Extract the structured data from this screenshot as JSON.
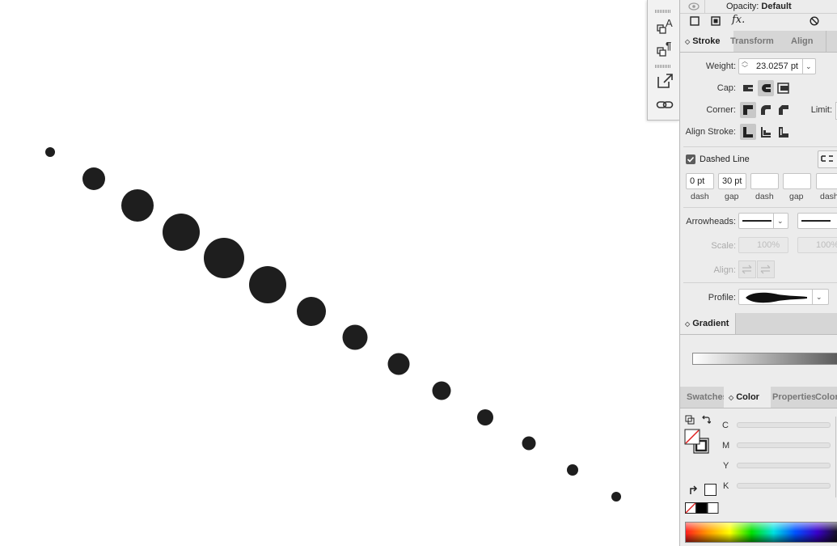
{
  "effects_panel": {
    "opacity_label": "Opacity:",
    "opacity_value": "Default",
    "fx_label": "fx."
  },
  "stroke_panel": {
    "tabs": [
      {
        "label": "Stroke",
        "active": true
      },
      {
        "label": "Transform",
        "active": false
      },
      {
        "label": "Align",
        "active": false
      }
    ],
    "weight_label": "Weight:",
    "weight_value": "23.0257 pt",
    "cap_label": "Cap:",
    "corner_label": "Corner:",
    "limit_label": "Limit:",
    "align_stroke_label": "Align Stroke:",
    "dashed_line": {
      "label": "Dashed Line",
      "checked": true
    },
    "dash_fields": [
      {
        "value": "0 pt",
        "caption": "dash"
      },
      {
        "value": "30 pt",
        "caption": "gap"
      },
      {
        "value": "",
        "caption": "dash"
      },
      {
        "value": "",
        "caption": "gap"
      },
      {
        "value": "",
        "caption": "dash"
      }
    ],
    "arrowheads_label": "Arrowheads:",
    "scale_label": "Scale:",
    "scale_start": "100%",
    "scale_end": "100%",
    "align_label": "Align:",
    "profile_label": "Profile:"
  },
  "gradient_panel": {
    "tab": "Gradient"
  },
  "color_panel": {
    "tabs": [
      {
        "label": "Swatches",
        "active": false
      },
      {
        "label": "Color",
        "active": true
      },
      {
        "label": "Properties",
        "active": false
      },
      {
        "label": "Color",
        "active": false
      }
    ],
    "channels": [
      "C",
      "M",
      "Y",
      "K"
    ]
  },
  "colors": {
    "dot": "#1e1e1e",
    "panel_bg": "#ececec",
    "tab_bar": "#d6d6d6",
    "none_red": "#e02020"
  }
}
